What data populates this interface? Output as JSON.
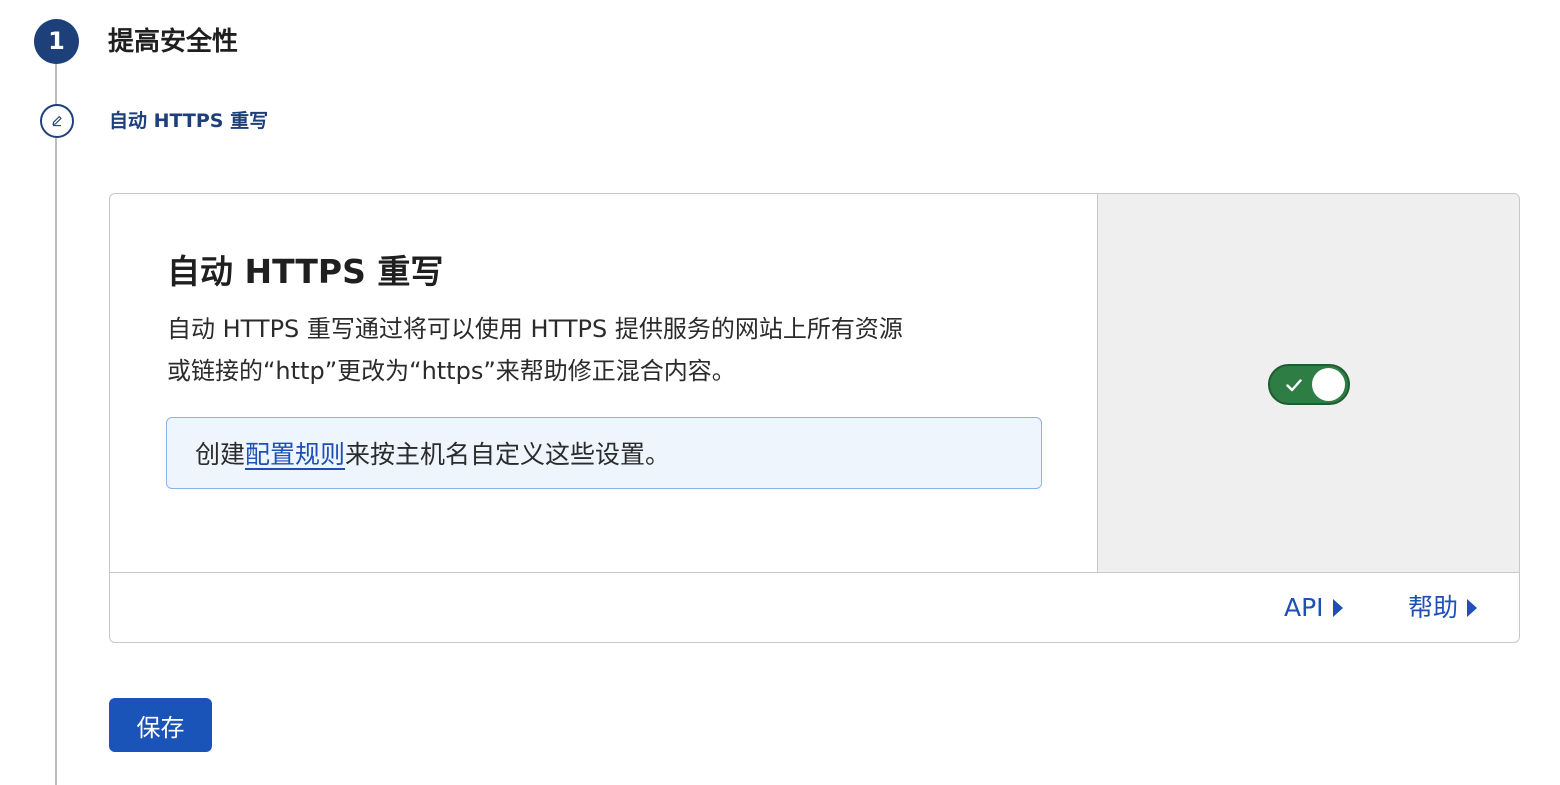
{
  "step": {
    "number": "1",
    "title": "提高安全性"
  },
  "sub_step": {
    "icon": "pencil-icon",
    "title": "自动 HTTPS 重写"
  },
  "card": {
    "title": "自动 HTTPS 重写",
    "description_line1": "自动 HTTPS 重写通过将可以使用 HTTPS 提供服务的网站上所有资源",
    "description_line2": "或链接的“http”更改为“https”来帮助修正混合内容。",
    "info": {
      "prefix": "创建",
      "link": "配置规则",
      "suffix": "来按主机名自定义这些设置。"
    },
    "toggle": {
      "state": "on",
      "icon": "check-icon",
      "color": "#2e7d45"
    },
    "footer": {
      "api_label": "API",
      "help_label": "帮助",
      "icon": "caret-right-icon"
    }
  },
  "save_label": "保存",
  "colors": {
    "accent": "#1a54b8",
    "step_badge": "#1d3f7a",
    "toggle_on": "#2e7d45",
    "info_bg": "#eef5fd",
    "info_border": "#8ab4e8"
  }
}
